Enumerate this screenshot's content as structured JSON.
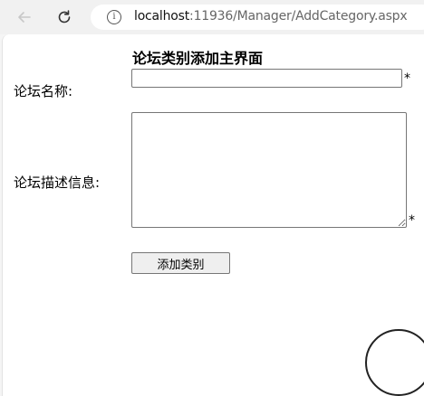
{
  "browser": {
    "url_host": "localhost",
    "url_path": ":11936/Manager/AddCategory.aspx",
    "info_icon_glyph": "i",
    "back_icon": "arrow-left-icon",
    "reload_icon": "reload-icon"
  },
  "form": {
    "title": "论坛类别添加主界面",
    "name_label": "论坛名称:",
    "name_value": "",
    "desc_label": "论坛描述信息:",
    "desc_value": "",
    "required_mark": "*",
    "submit_label": "添加类别"
  }
}
